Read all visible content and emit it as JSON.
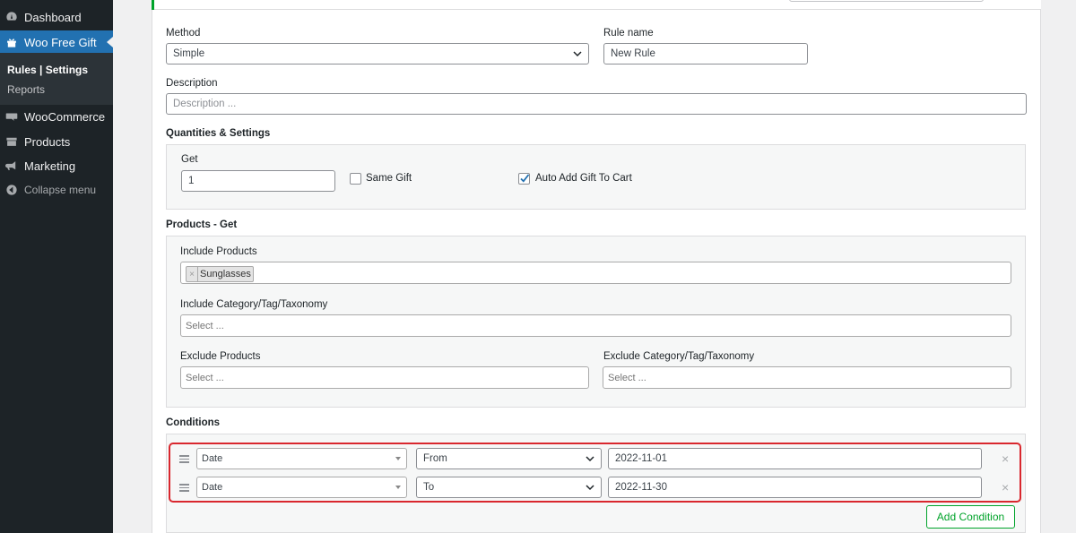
{
  "sidebar": {
    "items": [
      {
        "label": "Dashboard",
        "icon": "dashboard-icon"
      },
      {
        "label": "Woo Free Gift",
        "icon": "gift-icon"
      },
      {
        "label": "WooCommerce",
        "icon": "woocommerce-icon"
      },
      {
        "label": "Products",
        "icon": "products-icon"
      },
      {
        "label": "Marketing",
        "icon": "megaphone-icon"
      }
    ],
    "submenu": {
      "rules_settings": "Rules | Settings",
      "reports": "Reports"
    },
    "collapse": "Collapse menu"
  },
  "form": {
    "method_label": "Method",
    "method_value": "Simple",
    "rule_name_label": "Rule name",
    "rule_name_value": "New Rule",
    "description_label": "Description",
    "description_placeholder": "Description ...",
    "quantities_title": "Quantities & Settings",
    "get_label": "Get",
    "get_value": "1",
    "same_gift_label": "Same Gift",
    "same_gift_checked": false,
    "auto_add_label": "Auto Add Gift To Cart",
    "auto_add_checked": true,
    "products_title": "Products - Get",
    "include_products_label": "Include Products",
    "include_products_tag": "Sunglasses",
    "include_category_label": "Include Category/Tag/Taxonomy",
    "include_category_placeholder": "Select ...",
    "exclude_products_label": "Exclude Products",
    "exclude_products_placeholder": "Select ...",
    "exclude_category_label": "Exclude Category/Tag/Taxonomy",
    "exclude_category_placeholder": "Select ...",
    "conditions_title": "Conditions",
    "conditions": [
      {
        "type": "Date",
        "operator": "From",
        "value": "2022-11-01"
      },
      {
        "type": "Date",
        "operator": "To",
        "value": "2022-11-30"
      }
    ],
    "remove_symbol": "×",
    "add_condition_label": "Add Condition"
  },
  "colors": {
    "accent": "#2271b1",
    "highlight": "#d9272e",
    "success": "#00a32a",
    "sidebar": "#1d2327"
  }
}
